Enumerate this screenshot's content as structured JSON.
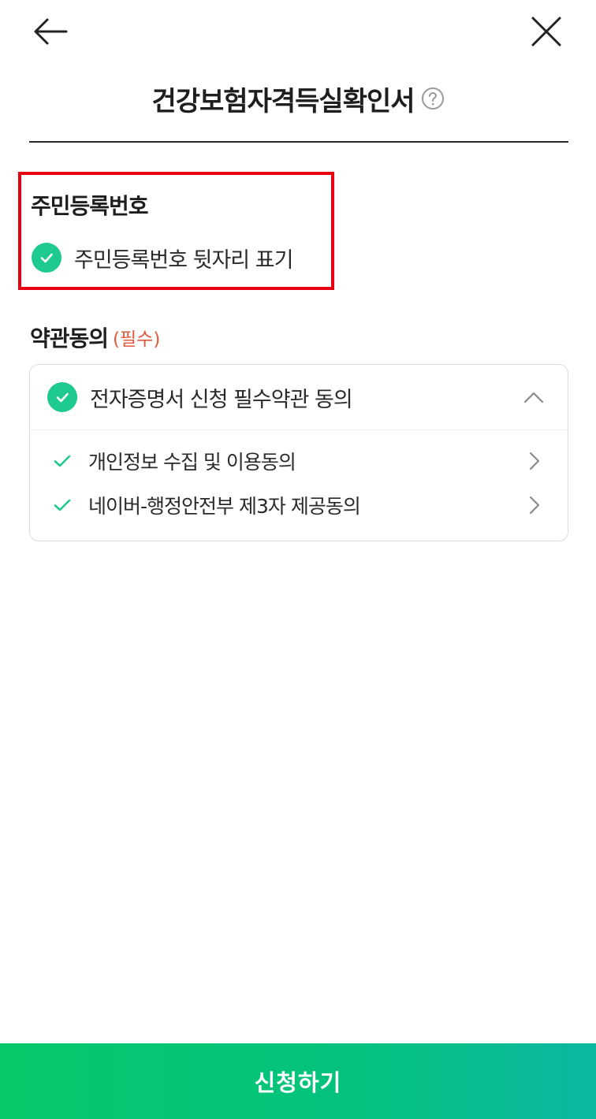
{
  "header": {
    "title": "건강보험자격득실확인서",
    "back_icon": "arrow-left-icon",
    "close_icon": "close-icon",
    "help_icon": "question-circle-icon"
  },
  "rrn_section": {
    "heading": "주민등록번호",
    "option_label": "주민등록번호 뒷자리 표기",
    "option_checked": true
  },
  "terms": {
    "heading": "약관동의",
    "required_tag": "(필수)",
    "main": {
      "label": "전자증명서 신청 필수약관 동의",
      "checked": true,
      "expanded": true
    },
    "items": [
      {
        "label": "개인정보 수집 및 이용동의",
        "checked": true
      },
      {
        "label": "네이버-행정안전부 제3자 제공동의",
        "checked": true
      }
    ]
  },
  "footer": {
    "submit_label": "신청하기"
  },
  "colors": {
    "accent_green": "#1fca8f",
    "highlight_red": "#e60012",
    "required_red": "#e05a3f",
    "button_gradient_start": "#05c86a",
    "button_gradient_end": "#0ab7a0"
  }
}
